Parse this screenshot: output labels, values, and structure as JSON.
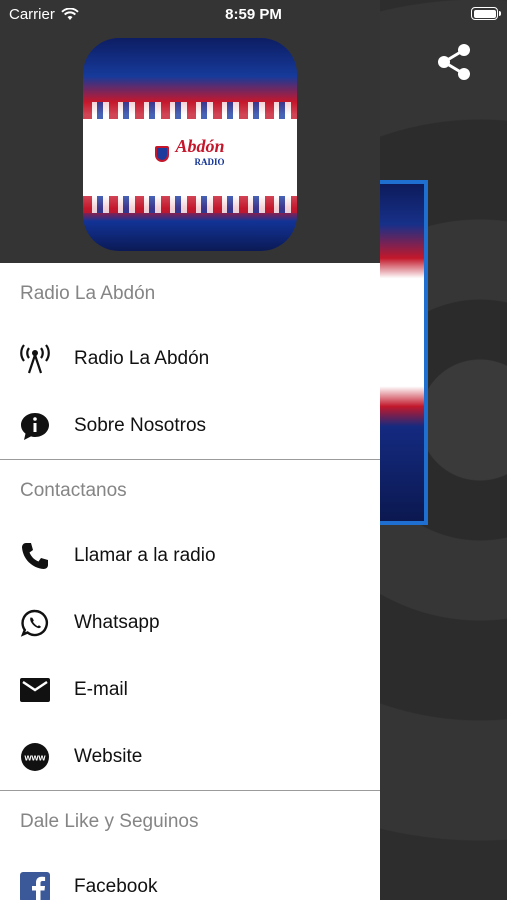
{
  "status_bar": {
    "carrier": "Carrier",
    "time": "8:59 PM",
    "battery_level": 1.0
  },
  "header": {
    "logo_text": "Abdón",
    "logo_sub": "RADIO"
  },
  "sections": [
    {
      "title": "Radio La Abdón",
      "items": [
        {
          "label": "Radio La Abdón",
          "icon": "radio-tower-icon"
        },
        {
          "label": "Sobre Nosotros",
          "icon": "info-chat-icon"
        }
      ]
    },
    {
      "title": "Contactanos",
      "items": [
        {
          "label": "Llamar a la radio",
          "icon": "phone-icon"
        },
        {
          "label": "Whatsapp",
          "icon": "whatsapp-icon"
        },
        {
          "label": "E-mail",
          "icon": "mail-icon"
        },
        {
          "label": "Website",
          "icon": "www-icon"
        }
      ]
    },
    {
      "title": "Dale Like y Seguinos",
      "items": [
        {
          "label": "Facebook",
          "icon": "facebook-icon"
        }
      ]
    }
  ],
  "colors": {
    "drawer_bg": "#ffffff",
    "header_bg": "#343434",
    "section_text": "#858585",
    "accent_blue": "#1f6fd1",
    "facebook": "#3b5998"
  }
}
